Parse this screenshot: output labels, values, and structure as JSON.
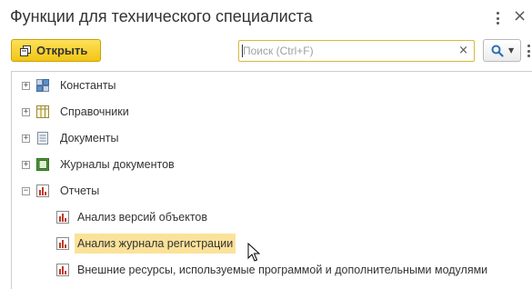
{
  "window": {
    "title": "Функции для технического специалиста"
  },
  "toolbar": {
    "open_label": "Открыть",
    "search_placeholder": "Поиск (Ctrl+F)",
    "search_value": ""
  },
  "icons": {
    "menu": "kebab-menu-icon",
    "close": "close-icon",
    "open": "open-form-icon",
    "clear": "clear-icon",
    "search": "magnifier-icon",
    "more": "more-actions-icon"
  },
  "tree": {
    "items": [
      {
        "label": "Константы",
        "icon": "constants-icon",
        "expander": "+"
      },
      {
        "label": "Справочники",
        "icon": "catalogs-icon",
        "expander": "+"
      },
      {
        "label": "Документы",
        "icon": "documents-icon",
        "expander": "+"
      },
      {
        "label": "Журналы документов",
        "icon": "document-journals-icon",
        "expander": "+"
      },
      {
        "label": "Отчеты",
        "icon": "reports-icon",
        "expander": "−",
        "children": [
          {
            "label": "Анализ версий объектов",
            "icon": "report-icon"
          },
          {
            "label": "Анализ журнала регистрации",
            "icon": "report-icon",
            "selected": true
          },
          {
            "label": "Внешние ресурсы, используемые программой и дополнительными модулями",
            "icon": "report-icon"
          }
        ]
      }
    ]
  },
  "colors": {
    "accent_button": "#f2c514",
    "selection": "#fbe29a",
    "search_border": "#d8b93a"
  }
}
